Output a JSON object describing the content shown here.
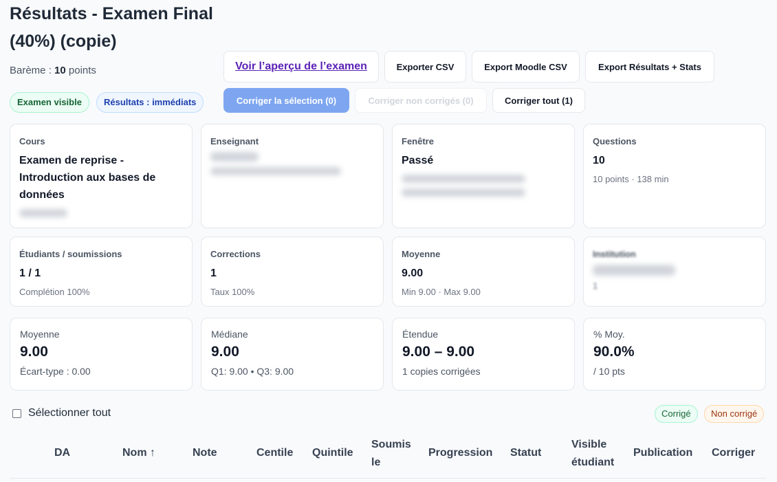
{
  "header": {
    "title": "Résultats - Examen Final (40%) (copie)",
    "bareme_label": "Barème : ",
    "bareme_value": "10",
    "bareme_unit": " points",
    "badge_visible": "Examen visible",
    "badge_results": "Résultats : immédiats"
  },
  "toolbar": {
    "preview_label": "Voir l’aperçu de l’examen",
    "export_csv": "Exporter CSV",
    "export_moodle": "Export Moodle CSV",
    "export_stats": "Export Résultats + Stats",
    "grade_selection": "Corriger la sélection (0)",
    "grade_ungraded": "Corriger non corrigés (0)",
    "grade_all": "Corriger tout (1)"
  },
  "info_cards": {
    "course": {
      "label": "Cours",
      "value": "Examen de reprise - Introduction aux bases de données"
    },
    "teacher": {
      "label": "Enseignant"
    },
    "window": {
      "label": "Fenêtre",
      "value": "Passé"
    },
    "questions": {
      "label": "Questions",
      "value": "10",
      "sub": "10 points · 138 min"
    },
    "students": {
      "label": "Étudiants / soumissions",
      "value": "1 / 1",
      "sub": "Complétion 100%"
    },
    "corrections": {
      "label": "Corrections",
      "value": "1",
      "sub": "Taux 100%"
    },
    "average": {
      "label": "Moyenne",
      "value": "9.00",
      "sub": "Min 9.00 · Max 9.00"
    },
    "institution": {
      "label": "Institution",
      "sub": "1"
    }
  },
  "stats": {
    "mean": {
      "label": "Moyenne",
      "value": "9.00",
      "sub": "Écart-type : 0.00"
    },
    "median": {
      "label": "Médiane",
      "value": "9.00",
      "sub": "Q1: 9.00 • Q3: 9.00"
    },
    "range": {
      "label": "Étendue",
      "value": "9.00 – 9.00",
      "sub": "1 copies corrigées"
    },
    "percent": {
      "label": "% Moy.",
      "value": "90.0%",
      "sub": "/ 10 pts"
    }
  },
  "table": {
    "select_all": "Sélectionner tout",
    "legend_graded": "Corrigé",
    "legend_ungraded": "Non corrigé",
    "columns": {
      "da": "DA",
      "name": "Nom ↑",
      "grade": "Note",
      "centile": "Centile",
      "quintile": "Quintile",
      "submitted": "Soumis le",
      "progress": "Progression",
      "status": "Statut",
      "visible": "Visible étudiant",
      "publication": "Publication",
      "correct": "Corriger"
    }
  },
  "colors": {
    "primary_button": "#7ea6f0",
    "link": "#5b21b6",
    "graded_green": "#166534",
    "ungraded_orange": "#9a3412"
  }
}
